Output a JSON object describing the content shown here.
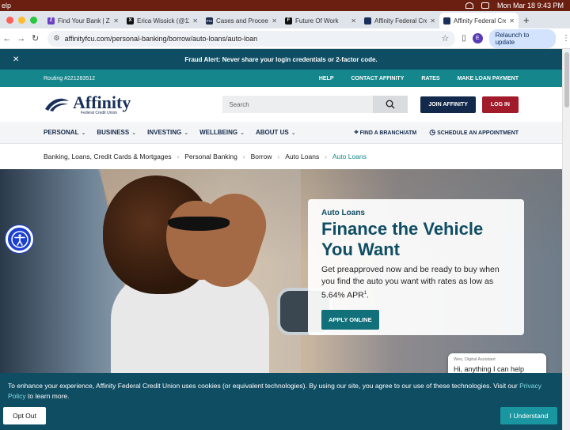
{
  "menubar": {
    "app": "elp",
    "clock": "Mon Mar 18  9:43 PM"
  },
  "tabs": [
    {
      "title": "Find Your Bank | Ze",
      "fav": "Z",
      "color": "#6b3fc4"
    },
    {
      "title": "Erica Wissick (@110",
      "fav": "X",
      "color": "#111111"
    },
    {
      "title": "Cases and Proceed",
      "fav": "FTC",
      "color": "#1c2c4a"
    },
    {
      "title": "Future Of Work",
      "fav": "F",
      "color": "#111111"
    },
    {
      "title": "Affinity Federal Cre",
      "fav": "",
      "color": "#1a2f5a"
    },
    {
      "title": "Affinity Federal Cre",
      "fav": "",
      "color": "#1a2f5a"
    }
  ],
  "address": {
    "url": "affinityfcu.com/personal-banking/borrow/auto-loans/auto-loan",
    "relaunch": "Relaunch to update",
    "profile": "E"
  },
  "alert": {
    "text": "Fraud Alert: Never share your login credentials or 2-factor code."
  },
  "routing": {
    "number": "Routing #221283512",
    "links": [
      "HELP",
      "CONTACT AFFINITY",
      "RATES",
      "MAKE LOAN PAYMENT"
    ]
  },
  "header": {
    "logo_name": "Affinity",
    "logo_sub": "Federal Credit Union",
    "search_placeholder": "Search",
    "join": "JOIN AFFINITY",
    "login": "LOG IN"
  },
  "nav": {
    "items": [
      "PERSONAL",
      "BUSINESS",
      "INVESTING",
      "WELLBEING",
      "ABOUT US"
    ],
    "find": "FIND A BRANCH/ATM",
    "schedule": "SCHEDULE AN APPOINTMENT"
  },
  "breadcrumbs": [
    "Banking, Loans, Credit Cards & Mortgages",
    "Personal Banking",
    "Borrow",
    "Auto Loans",
    "Auto Loans"
  ],
  "hero": {
    "kicker": "Auto Loans",
    "title": "Finance the Vehicle You Want",
    "desc": "Get preapproved now and be ready to buy when you find the auto you want with rates as low as 5.64% APR",
    "footnote": "1",
    "apply": "APPLY ONLINE"
  },
  "chat": {
    "who": "Wes, Digital Assistant",
    "msg": "Hi, anything I can help with?"
  },
  "cookie": {
    "text": "To enhance your experience, Affinity Federal Credit Union uses cookies (or equivalent technologies). By using our site, you agree to our use of these technologies. Visit our",
    "link": "Privacy Policy",
    "suffix": " to learn more.",
    "optout": "Opt Out",
    "agree": "I Understand"
  },
  "colors": {
    "teal_dark": "#0f4d63",
    "teal": "#14868c",
    "navy": "#13294b",
    "red": "#a11b2b"
  }
}
